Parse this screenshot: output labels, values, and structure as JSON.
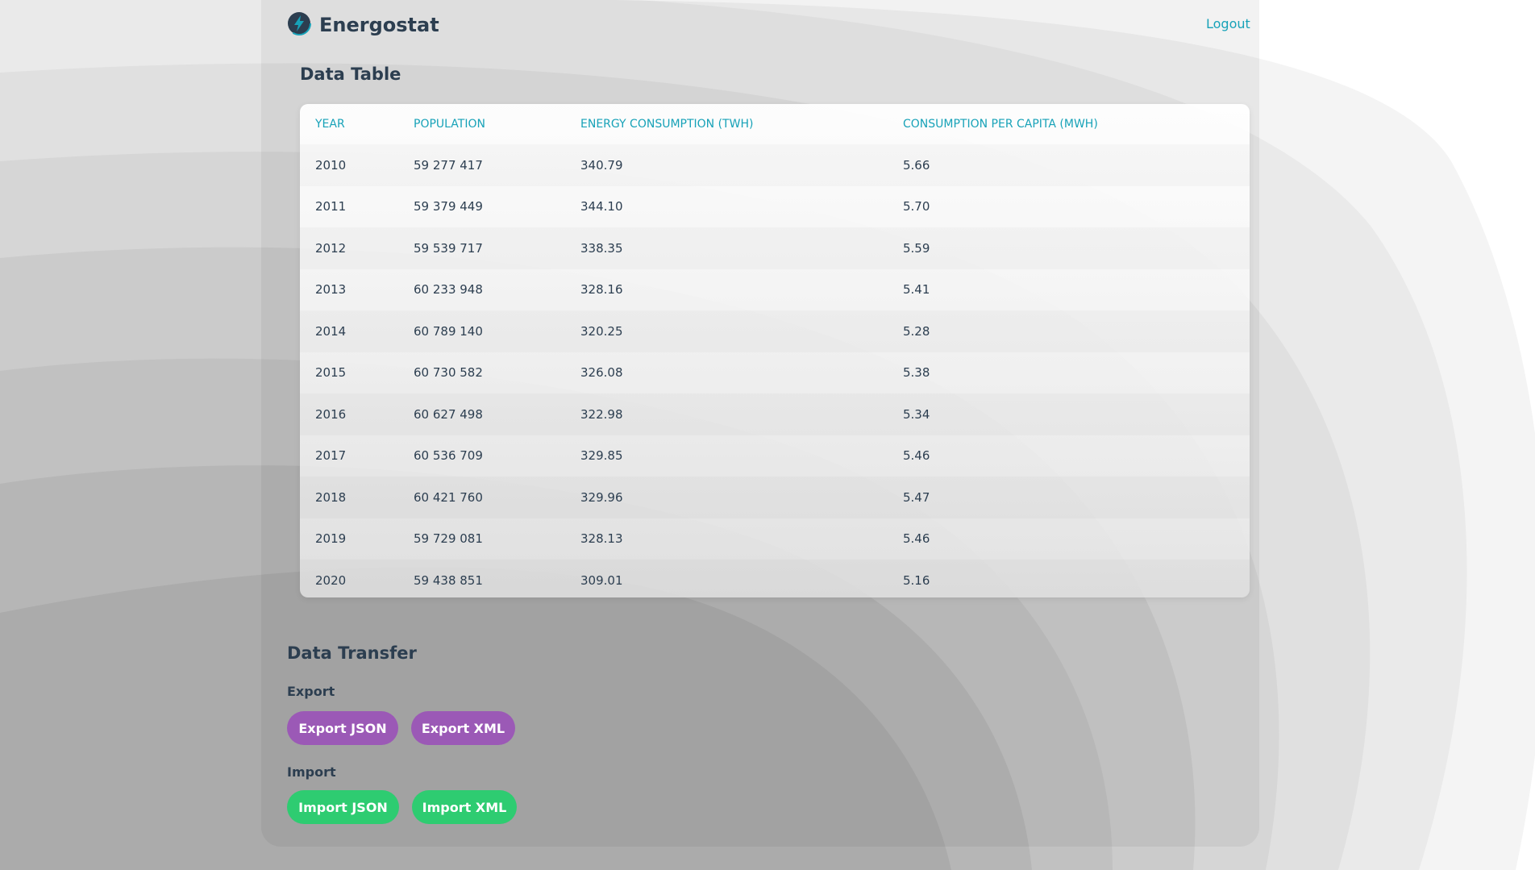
{
  "header": {
    "brand": "Energostat",
    "logout_label": "Logout"
  },
  "table_section": {
    "title": "Data Table",
    "columns": [
      "YEAR",
      "POPULATION",
      "ENERGY CONSUMPTION (TWH)",
      "CONSUMPTION PER CAPITA (MWH)"
    ],
    "rows": [
      [
        "2010",
        "59 277 417",
        "340.79",
        "5.66"
      ],
      [
        "2011",
        "59 379 449",
        "344.10",
        "5.70"
      ],
      [
        "2012",
        "59 539 717",
        "338.35",
        "5.59"
      ],
      [
        "2013",
        "60 233 948",
        "328.16",
        "5.41"
      ],
      [
        "2014",
        "60 789 140",
        "320.25",
        "5.28"
      ],
      [
        "2015",
        "60 730 582",
        "326.08",
        "5.38"
      ],
      [
        "2016",
        "60 627 498",
        "322.98",
        "5.34"
      ],
      [
        "2017",
        "60 536 709",
        "329.85",
        "5.46"
      ],
      [
        "2018",
        "60 421 760",
        "329.96",
        "5.47"
      ],
      [
        "2019",
        "59 729 081",
        "328.13",
        "5.46"
      ],
      [
        "2020",
        "59 438 851",
        "309.01",
        "5.16"
      ]
    ]
  },
  "transfer": {
    "title": "Data Transfer",
    "export_label": "Export",
    "import_label": "Import",
    "export_json": "Export JSON",
    "export_xml": "Export XML",
    "import_json": "Import JSON",
    "import_xml": "Import XML"
  },
  "colors": {
    "accent": "#17a2b8",
    "export_button": "#9b59b6",
    "import_button": "#2ecc71",
    "text": "#2c3e50"
  },
  "icons": {
    "logo": "lightning-bolt-icon"
  }
}
